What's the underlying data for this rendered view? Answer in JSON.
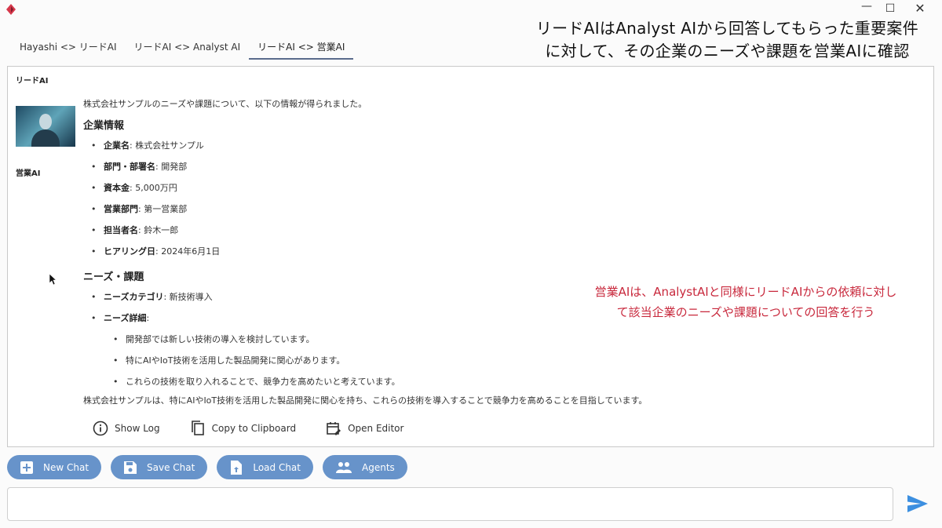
{
  "window": {
    "icon": "app-logo-icon",
    "minimize_label": "—",
    "maximize_label": "☐",
    "close_label": "✕"
  },
  "tabs": [
    {
      "label": "Hayashi <> リードAI",
      "active": false
    },
    {
      "label": "リードAI <> Analyst AI",
      "active": false
    },
    {
      "label": "リードAI <> 営業AI",
      "active": true
    }
  ],
  "annotations": {
    "top_line1": "リードAIはAnalyst AIから回答してもらった重要案件",
    "top_line2": "に対して、その企業のニーズや課題を営業AIに確認",
    "red_line1": "営業AIは、AnalystAIと同様にリードAIからの依頼に対し",
    "red_line2": "て該当企業のニーズや課題についての回答を行う"
  },
  "chat": {
    "top_sender": "リードAI",
    "sender": "営業AI",
    "intro": "株式会社サンプルのニーズや課題について、以下の情報が得られました。",
    "company_heading": "企業情報",
    "company_items": [
      {
        "key": "企業名",
        "value": ": 株式会社サンプル"
      },
      {
        "key": "部門・部署名",
        "value": ": 開発部"
      },
      {
        "key": "資本金",
        "value": ": 5,000万円"
      },
      {
        "key": "営業部門",
        "value": ": 第一営業部"
      },
      {
        "key": "担当者名",
        "value": ": 鈴木一郎"
      },
      {
        "key": "ヒアリング日",
        "value": ": 2024年6月1日"
      }
    ],
    "needs_heading": "ニーズ・課題",
    "needs_category_key": "ニーズカテゴリ",
    "needs_category_value": ": 新技術導入",
    "needs_detail_key": "ニーズ詳細",
    "needs_detail_suffix": ":",
    "needs_details": [
      "開発部では新しい技術の導入を検討しています。",
      "特にAIやIoT技術を活用した製品開発に関心があります。",
      "これらの技術を取り入れることで、競争力を高めたいと考えています。"
    ],
    "summary": "株式会社サンプルは、特にAIやIoT技術を活用した製品開発に関心を持ち、これらの技術を導入することで競争力を高めることを目指しています。",
    "actions": {
      "show_log": "Show Log",
      "copy": "Copy to Clipboard",
      "open_editor": "Open Editor"
    }
  },
  "buttons": {
    "new_chat": "New Chat",
    "save_chat": "Save Chat",
    "load_chat": "Load Chat",
    "agents": "Agents"
  },
  "input": {
    "placeholder": ""
  },
  "colors": {
    "accent": "#5b8bc6",
    "annotation_red": "#c8283c"
  }
}
